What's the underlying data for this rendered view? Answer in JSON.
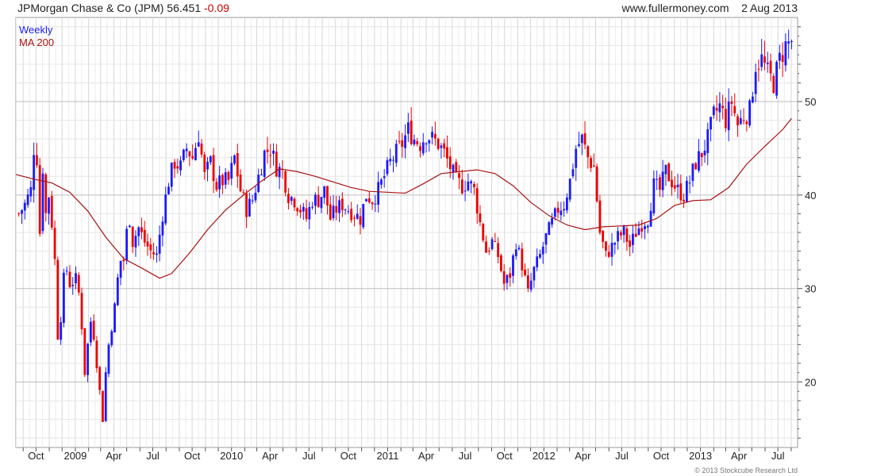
{
  "header": {
    "title": "JPMorgan Chase & Co (JPM)",
    "price": "56.451",
    "change": "-0.09",
    "website": "www.fullermoney.com",
    "date": "2 Aug 2013"
  },
  "footer": {
    "copyright": "© 2013 Stockcube Research Ltd"
  },
  "colors": {
    "up": "#1a1aff",
    "down": "#ee0000",
    "ma": "#aa1111",
    "grid": "#d8d8d8"
  },
  "chart_data": {
    "type": "candlestick",
    "frequency": "Weekly",
    "legend": [
      {
        "name": "Weekly",
        "color": "#1a1aff"
      },
      {
        "name": "MA 200",
        "color": "#aa1111"
      }
    ],
    "legend_position": "top-left",
    "grid": true,
    "y_axis": {
      "position": "right",
      "range": [
        13,
        59
      ],
      "ticks": [
        20,
        30,
        40,
        50
      ]
    },
    "x_range": [
      "2008-08-15",
      "2013-08-16"
    ],
    "x_ticks": [
      {
        "date": "2008-10-01",
        "label": "Oct"
      },
      {
        "date": "2009-01-01",
        "label": "2009"
      },
      {
        "date": "2009-04-01",
        "label": "Apr"
      },
      {
        "date": "2009-07-01",
        "label": "Jul"
      },
      {
        "date": "2009-10-01",
        "label": "Oct"
      },
      {
        "date": "2010-01-01",
        "label": "2010"
      },
      {
        "date": "2010-04-01",
        "label": "Apr"
      },
      {
        "date": "2010-07-01",
        "label": "Jul"
      },
      {
        "date": "2010-10-01",
        "label": "Oct"
      },
      {
        "date": "2011-01-01",
        "label": "2011"
      },
      {
        "date": "2011-04-01",
        "label": "Apr"
      },
      {
        "date": "2011-07-01",
        "label": "Jul"
      },
      {
        "date": "2011-10-01",
        "label": "Oct"
      },
      {
        "date": "2012-01-01",
        "label": "2012"
      },
      {
        "date": "2012-04-01",
        "label": "Apr"
      },
      {
        "date": "2012-07-01",
        "label": "Jul"
      },
      {
        "date": "2012-10-01",
        "label": "Oct"
      },
      {
        "date": "2013-01-01",
        "label": "2013"
      },
      {
        "date": "2013-04-01",
        "label": "Apr"
      },
      {
        "date": "2013-07-01",
        "label": "Jul"
      }
    ],
    "close_series": [
      [
        "2008-08-22",
        38.0
      ],
      [
        "2008-09-05",
        39.0
      ],
      [
        "2008-09-19",
        40.5
      ],
      [
        "2008-09-26",
        45.0
      ],
      [
        "2008-10-03",
        44.0
      ],
      [
        "2008-10-10",
        36.0
      ],
      [
        "2008-10-17",
        43.0
      ],
      [
        "2008-10-24",
        38.0
      ],
      [
        "2008-10-31",
        40.0
      ],
      [
        "2008-11-07",
        37.0
      ],
      [
        "2008-11-14",
        33.0
      ],
      [
        "2008-11-21",
        25.0
      ],
      [
        "2008-11-28",
        27.0
      ],
      [
        "2008-12-05",
        31.0
      ],
      [
        "2008-12-12",
        32.0
      ],
      [
        "2008-12-19",
        30.5
      ],
      [
        "2009-01-02",
        31.0
      ],
      [
        "2009-01-09",
        29.5
      ],
      [
        "2009-01-16",
        26.0
      ],
      [
        "2009-01-23",
        21.0
      ],
      [
        "2009-01-30",
        24.0
      ],
      [
        "2009-02-06",
        26.5
      ],
      [
        "2009-02-13",
        25.0
      ],
      [
        "2009-02-20",
        22.0
      ],
      [
        "2009-02-27",
        19.0
      ],
      [
        "2009-03-06",
        16.0
      ],
      [
        "2009-03-13",
        21.0
      ],
      [
        "2009-03-20",
        24.0
      ],
      [
        "2009-03-27",
        26.0
      ],
      [
        "2009-04-03",
        28.0
      ],
      [
        "2009-04-10",
        31.0
      ],
      [
        "2009-04-17",
        33.0
      ],
      [
        "2009-04-24",
        33.0
      ],
      [
        "2009-05-01",
        36.0
      ],
      [
        "2009-05-08",
        37.5
      ],
      [
        "2009-05-15",
        35.0
      ],
      [
        "2009-05-29",
        36.5
      ],
      [
        "2009-06-12",
        35.0
      ],
      [
        "2009-06-26",
        34.0
      ],
      [
        "2009-07-10",
        33.5
      ],
      [
        "2009-07-24",
        38.0
      ],
      [
        "2009-08-07",
        41.5
      ],
      [
        "2009-08-21",
        43.5
      ],
      [
        "2009-09-04",
        43.0
      ],
      [
        "2009-09-18",
        45.0
      ],
      [
        "2009-10-02",
        44.0
      ],
      [
        "2009-10-16",
        46.5
      ],
      [
        "2009-10-30",
        42.0
      ],
      [
        "2009-11-13",
        43.5
      ],
      [
        "2009-11-27",
        41.0
      ],
      [
        "2009-12-11",
        41.5
      ],
      [
        "2009-12-25",
        41.5
      ],
      [
        "2010-01-08",
        44.0
      ],
      [
        "2010-01-22",
        40.5
      ],
      [
        "2010-02-05",
        38.5
      ],
      [
        "2010-02-19",
        39.5
      ],
      [
        "2010-03-05",
        42.0
      ],
      [
        "2010-03-19",
        44.5
      ],
      [
        "2010-04-02",
        45.0
      ],
      [
        "2010-04-16",
        43.0
      ],
      [
        "2010-04-30",
        42.5
      ],
      [
        "2010-05-14",
        40.0
      ],
      [
        "2010-05-28",
        39.5
      ],
      [
        "2010-06-11",
        38.5
      ],
      [
        "2010-06-25",
        37.5
      ],
      [
        "2010-07-09",
        39.5
      ],
      [
        "2010-07-23",
        39.5
      ],
      [
        "2010-08-06",
        40.5
      ],
      [
        "2010-08-20",
        37.5
      ],
      [
        "2010-09-03",
        38.5
      ],
      [
        "2010-09-17",
        39.0
      ],
      [
        "2010-10-01",
        38.5
      ],
      [
        "2010-10-15",
        38.0
      ],
      [
        "2010-10-29",
        37.5
      ],
      [
        "2010-11-12",
        40.0
      ],
      [
        "2010-11-26",
        39.5
      ],
      [
        "2010-12-10",
        40.5
      ],
      [
        "2010-12-24",
        42.0
      ],
      [
        "2011-01-07",
        43.5
      ],
      [
        "2011-01-21",
        44.5
      ],
      [
        "2011-02-04",
        45.5
      ],
      [
        "2011-02-18",
        47.0
      ],
      [
        "2011-03-04",
        46.0
      ],
      [
        "2011-03-18",
        45.5
      ],
      [
        "2011-04-01",
        46.5
      ],
      [
        "2011-04-15",
        46.0
      ],
      [
        "2011-04-29",
        45.5
      ],
      [
        "2011-05-13",
        44.5
      ],
      [
        "2011-05-27",
        43.0
      ],
      [
        "2011-06-10",
        41.5
      ],
      [
        "2011-06-24",
        41.0
      ],
      [
        "2011-07-08",
        41.5
      ],
      [
        "2011-07-22",
        40.5
      ],
      [
        "2011-08-05",
        37.0
      ],
      [
        "2011-08-19",
        34.0
      ],
      [
        "2011-09-02",
        35.0
      ],
      [
        "2011-09-16",
        33.5
      ],
      [
        "2011-09-30",
        30.5
      ],
      [
        "2011-10-14",
        31.5
      ],
      [
        "2011-10-28",
        35.0
      ],
      [
        "2011-11-11",
        32.5
      ],
      [
        "2011-11-25",
        29.5
      ],
      [
        "2011-12-09",
        32.0
      ],
      [
        "2011-12-23",
        33.5
      ],
      [
        "2012-01-06",
        35.5
      ],
      [
        "2012-01-20",
        37.0
      ],
      [
        "2012-02-03",
        38.5
      ],
      [
        "2012-02-17",
        39.0
      ],
      [
        "2012-03-02",
        41.5
      ],
      [
        "2012-03-16",
        45.0
      ],
      [
        "2012-03-30",
        46.0
      ],
      [
        "2012-04-13",
        44.0
      ],
      [
        "2012-04-27",
        43.0
      ],
      [
        "2012-05-11",
        36.0
      ],
      [
        "2012-05-25",
        33.5
      ],
      [
        "2012-06-08",
        34.5
      ],
      [
        "2012-06-22",
        35.5
      ],
      [
        "2012-07-06",
        36.0
      ],
      [
        "2012-07-20",
        34.5
      ],
      [
        "2012-08-03",
        36.0
      ],
      [
        "2012-08-17",
        37.0
      ],
      [
        "2012-08-31",
        37.5
      ],
      [
        "2012-09-14",
        41.0
      ],
      [
        "2012-09-28",
        40.5
      ],
      [
        "2012-10-12",
        42.5
      ],
      [
        "2012-10-26",
        41.5
      ],
      [
        "2012-11-09",
        40.5
      ],
      [
        "2012-11-23",
        40.0
      ],
      [
        "2012-12-07",
        41.5
      ],
      [
        "2012-12-21",
        43.5
      ],
      [
        "2013-01-04",
        44.5
      ],
      [
        "2013-01-18",
        46.0
      ],
      [
        "2013-02-01",
        48.5
      ],
      [
        "2013-02-15",
        49.5
      ],
      [
        "2013-03-01",
        48.0
      ],
      [
        "2013-03-15",
        50.0
      ],
      [
        "2013-03-29",
        47.5
      ],
      [
        "2013-04-12",
        48.5
      ],
      [
        "2013-04-26",
        49.0
      ],
      [
        "2013-05-10",
        54.0
      ],
      [
        "2013-05-24",
        54.5
      ],
      [
        "2013-06-07",
        53.0
      ],
      [
        "2013-06-21",
        52.0
      ],
      [
        "2013-07-05",
        54.5
      ],
      [
        "2013-07-19",
        56.0
      ],
      [
        "2013-08-02",
        56.45
      ]
    ],
    "ma200": [
      [
        "2008-08-15",
        42.2
      ],
      [
        "2008-09-26",
        41.7
      ],
      [
        "2008-11-07",
        41.3
      ],
      [
        "2008-12-19",
        40.3
      ],
      [
        "2009-01-30",
        38.3
      ],
      [
        "2009-03-13",
        35.5
      ],
      [
        "2009-04-24",
        33.2
      ],
      [
        "2009-06-05",
        32.2
      ],
      [
        "2009-07-17",
        31.1
      ],
      [
        "2009-08-14",
        31.6
      ],
      [
        "2009-09-25",
        33.8
      ],
      [
        "2009-11-06",
        36.3
      ],
      [
        "2009-12-18",
        38.4
      ],
      [
        "2010-01-29",
        40.0
      ],
      [
        "2010-03-12",
        41.5
      ],
      [
        "2010-04-23",
        42.8
      ],
      [
        "2010-06-04",
        42.5
      ],
      [
        "2010-07-16",
        42.0
      ],
      [
        "2010-08-27",
        41.4
      ],
      [
        "2010-10-08",
        40.8
      ],
      [
        "2010-11-19",
        40.4
      ],
      [
        "2010-12-31",
        40.3
      ],
      [
        "2011-02-11",
        40.2
      ],
      [
        "2011-03-25",
        41.2
      ],
      [
        "2011-05-06",
        42.3
      ],
      [
        "2011-06-17",
        42.5
      ],
      [
        "2011-07-29",
        42.7
      ],
      [
        "2011-09-09",
        42.3
      ],
      [
        "2011-10-21",
        41.0
      ],
      [
        "2011-12-02",
        39.2
      ],
      [
        "2012-01-13",
        37.8
      ],
      [
        "2012-02-24",
        36.8
      ],
      [
        "2012-04-06",
        36.3
      ],
      [
        "2012-05-18",
        36.6
      ],
      [
        "2012-06-29",
        36.7
      ],
      [
        "2012-08-10",
        36.8
      ],
      [
        "2012-09-21",
        37.5
      ],
      [
        "2012-11-02",
        38.9
      ],
      [
        "2012-12-14",
        39.4
      ],
      [
        "2013-01-25",
        39.5
      ],
      [
        "2013-03-08",
        40.8
      ],
      [
        "2013-04-19",
        43.3
      ],
      [
        "2013-05-31",
        45.2
      ],
      [
        "2013-07-12",
        47.0
      ],
      [
        "2013-08-02",
        48.2
      ]
    ]
  }
}
